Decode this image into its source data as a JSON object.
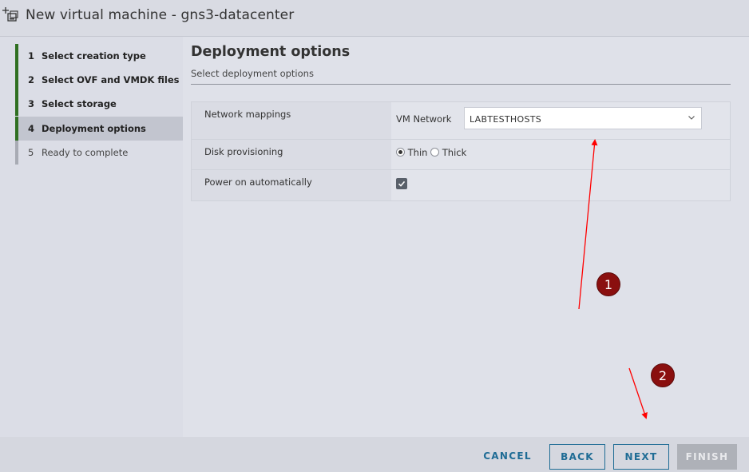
{
  "window": {
    "title": "New virtual machine - gns3-datacenter",
    "icon": "new-vm-icon"
  },
  "steps": [
    {
      "num": "1",
      "label": "Select creation type",
      "state": "done"
    },
    {
      "num": "2",
      "label": "Select OVF and VMDK files",
      "state": "done"
    },
    {
      "num": "3",
      "label": "Select storage",
      "state": "done"
    },
    {
      "num": "4",
      "label": "Deployment options",
      "state": "current"
    },
    {
      "num": "5",
      "label": "Ready to complete",
      "state": "todo"
    }
  ],
  "page": {
    "title": "Deployment options",
    "subtitle": "Select deployment options"
  },
  "options": {
    "network": {
      "label": "Network mappings",
      "source": "VM Network",
      "selected": "LABTESTHOSTS"
    },
    "disk": {
      "label": "Disk provisioning",
      "thin": "Thin",
      "thick": "Thick",
      "selected": "Thin"
    },
    "power": {
      "label": "Power on automatically",
      "checked": true
    }
  },
  "footer": {
    "cancel": "CANCEL",
    "back": "BACK",
    "next": "NEXT",
    "finish": "FINISH"
  },
  "annotations": [
    {
      "label": "1"
    },
    {
      "label": "2"
    }
  ],
  "colors": {
    "step_done": "#2f6f21",
    "button_text": "#1f6c95",
    "annotation": "#8a0f0f",
    "arrow": "#ff0000"
  }
}
